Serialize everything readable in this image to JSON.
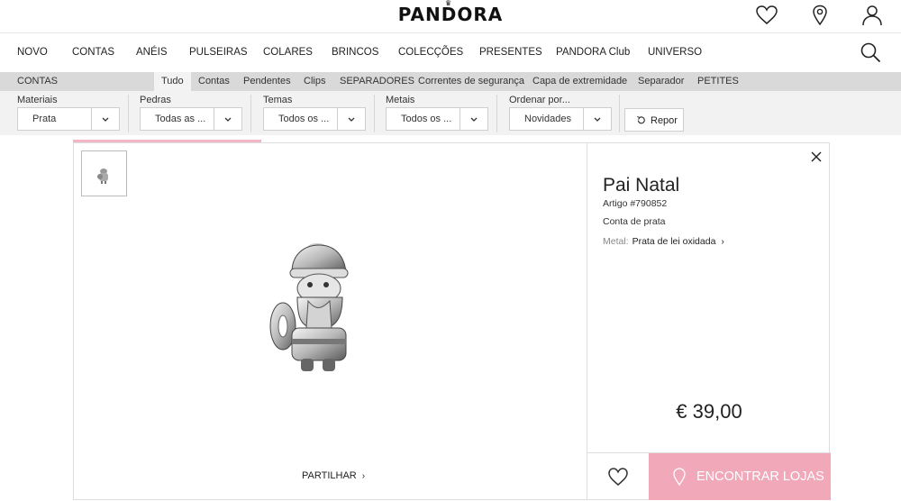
{
  "header": {
    "logo": "PANDORA",
    "icons": [
      "heart-icon",
      "location-pin-icon",
      "user-icon"
    ]
  },
  "main_nav": {
    "items": [
      "NOVO",
      "CONTAS",
      "ANÉIS",
      "PULSEIRAS",
      "COLARES",
      "BRINCOS",
      "COLECÇÕES",
      "PRESENTES",
      "PANDORA Club",
      "UNIVERSO"
    ]
  },
  "sub_nav": {
    "label": "CONTAS",
    "items": [
      "Tudo",
      "Contas",
      "Pendentes",
      "Clips",
      "SEPARADORES",
      "Correntes de segurança",
      "Capa de extremidade",
      "Separador",
      "PETITES"
    ],
    "active": "Tudo"
  },
  "filters": {
    "groups": [
      {
        "label": "Materiais",
        "value": "Prata"
      },
      {
        "label": "Pedras",
        "value": "Todas as ..."
      },
      {
        "label": "Temas",
        "value": "Todos os ..."
      },
      {
        "label": "Metais",
        "value": "Todos os ..."
      },
      {
        "label": "Ordenar por...",
        "value": "Novidades"
      }
    ],
    "reset_label": "Repor"
  },
  "product": {
    "name": "Pai Natal",
    "sku": "Artigo #790852",
    "description": "Conta de prata",
    "metal_label": "Metal:",
    "metal_value": "Prata de lei oxidada",
    "price": "€ 39,00",
    "share_label": "PARTILHAR",
    "find_stores_label": "ENCONTRAR LOJAS"
  },
  "colors": {
    "accent_pink": "#f1a9ba",
    "subnav_bg": "#d9d9d9",
    "filters_bg": "#f2f2f2"
  }
}
